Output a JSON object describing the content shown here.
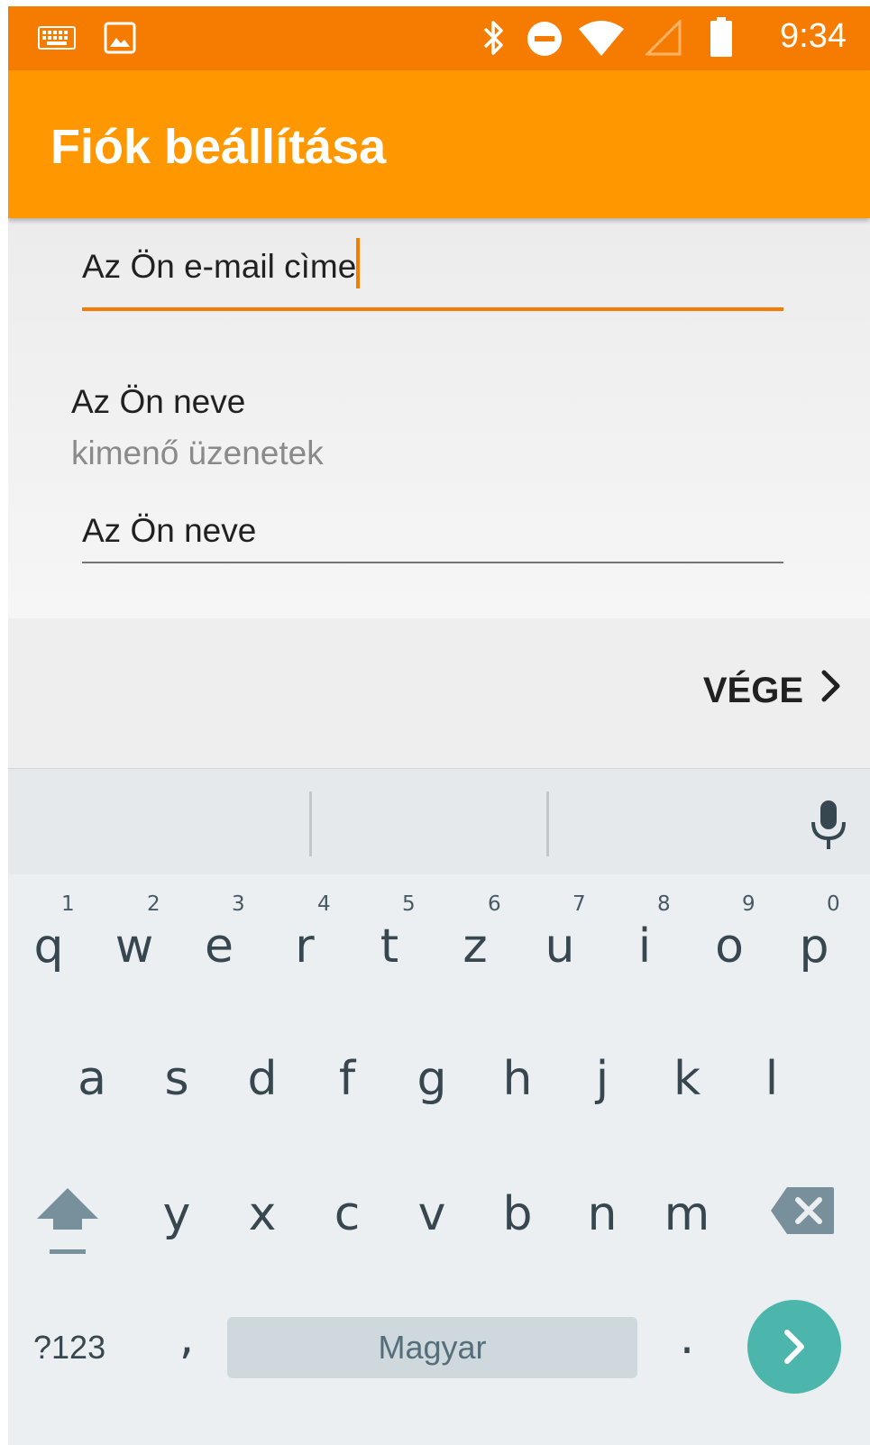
{
  "status_bar": {
    "time": "9:34",
    "icons": [
      "keyboard-icon",
      "image-icon",
      "bluetooth-icon",
      "do-not-disturb-icon",
      "wifi-icon",
      "signal-icon",
      "battery-icon"
    ],
    "color": "#f57c00"
  },
  "app_bar": {
    "title": "Fiók beállítása",
    "color": "#ff9800"
  },
  "form": {
    "email_field_value": "Az Ön e-mail cìme",
    "name_label": "Az Ön neve",
    "name_sublabel": "kimenő üzenetek",
    "name_field_value": "Az Ön neve",
    "accent": "#f57c00"
  },
  "footer": {
    "done_label": "VÉGE",
    "done_icon": "chevron-right-icon"
  },
  "keyboard": {
    "row1": [
      {
        "ch": "q",
        "hint": "1"
      },
      {
        "ch": "w",
        "hint": "2"
      },
      {
        "ch": "e",
        "hint": "3"
      },
      {
        "ch": "r",
        "hint": "4"
      },
      {
        "ch": "t",
        "hint": "5"
      },
      {
        "ch": "z",
        "hint": "6"
      },
      {
        "ch": "u",
        "hint": "7"
      },
      {
        "ch": "i",
        "hint": "8"
      },
      {
        "ch": "o",
        "hint": "9"
      },
      {
        "ch": "p",
        "hint": "0"
      }
    ],
    "row2": [
      "a",
      "s",
      "d",
      "f",
      "g",
      "h",
      "j",
      "k",
      "l"
    ],
    "row3": [
      "y",
      "x",
      "c",
      "v",
      "b",
      "n",
      "m"
    ],
    "symbols_label": "?123",
    "comma_label": ",",
    "space_label": "Magyar",
    "period_label": ".",
    "enter_color": "#4db6ac",
    "icons": [
      "shift-icon",
      "backspace-icon",
      "microphone-icon",
      "enter-arrow-icon"
    ]
  }
}
